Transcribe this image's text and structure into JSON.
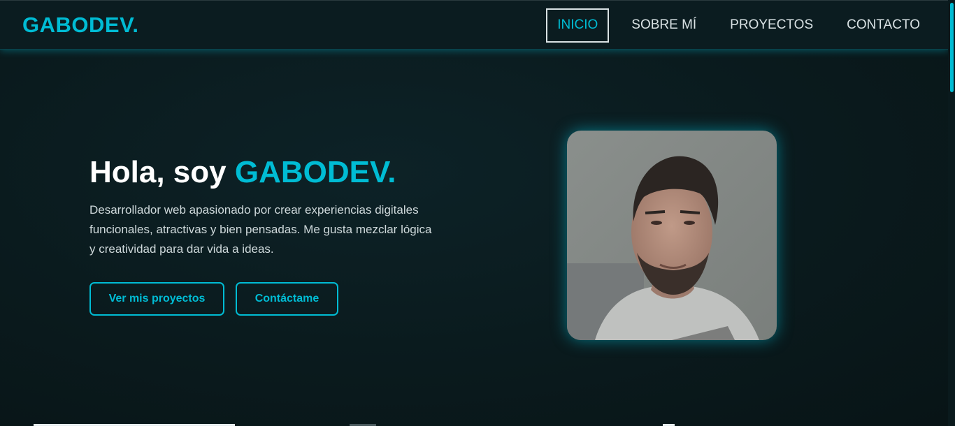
{
  "navbar": {
    "logo": "GABODEV.",
    "items": [
      {
        "label": "INICIO",
        "active": true
      },
      {
        "label": "SOBRE MÍ",
        "active": false
      },
      {
        "label": "PROYECTOS",
        "active": false
      },
      {
        "label": "CONTACTO",
        "active": false
      }
    ]
  },
  "hero": {
    "title_prefix": "Hola, soy ",
    "title_name": "GABODEV.",
    "description": "Desarrollador web apasionado por crear experiencias digitales funcionales, atractivas y bien pensadas. Me gusta mezclar lógica y creatividad para dar vida a ideas.",
    "buttons": {
      "projects": "Ver mis proyectos",
      "contact": "Contáctame"
    },
    "photo_icon": "profile-photo"
  },
  "colors": {
    "accent": "#00bcd4",
    "background": "#0a1a1d",
    "text": "#e6eef0"
  }
}
